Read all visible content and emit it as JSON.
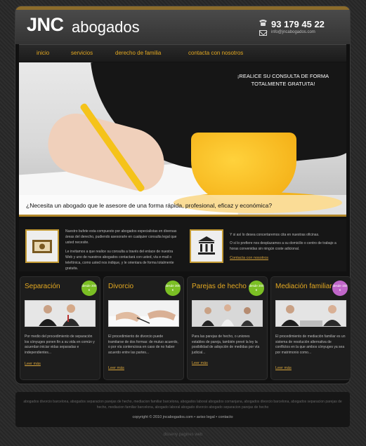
{
  "header": {
    "logo_bold": "JNC",
    "logo_rest": "abogados",
    "phone": "93 179 45 22",
    "email": "info@jncabogados.com"
  },
  "nav": {
    "items": [
      "inicio",
      "servicios",
      "derecho de familia",
      "contacta con nosotros"
    ]
  },
  "hero": {
    "promo_line1": "¡REALICE SU CONSULTA DE FORMA",
    "promo_line2": "TOTALMENTE GRATUITA!",
    "question": "¿Necesita un abogado que le asesore de una forma rápida, profesional, eficaz y económica?"
  },
  "info": {
    "left_p1": "Nuestro bufete esta compuesto por abogados especialistas en diversas áreas del derecho, pudiendo asesorarle en cualquier consulta legal que usted necesite.",
    "left_p2": "Le invitamos a que realice su consulta a través del enlace de nuestra Web y uno de nuestros abogados contactará con usted, vía e-mail o telefónica, como usted nos indique, y le orientara de forma totalmente gratuita.",
    "right_p1": "Y si así lo desea concertaremos cita en nuestras oficinas.",
    "right_p2": "O si lo prefiere nos desplazamos a su domicilio o centro de trabajo a horas convenidas sin ningún coste adicional.",
    "right_link": "Contacta con nosotros"
  },
  "cards": [
    {
      "title": "Separación",
      "badge": "desde 300 €",
      "text": "Por medio del procedimiento de separación los cónyuges ponen fin a su vida en común y acuerdan iniciar vidas separadas e independientes...",
      "more": "Leer más"
    },
    {
      "title": "Divorcio",
      "badge": "desde 300 €",
      "text": "El procedimiento de divorcio puede tramitarse de dos formas: de mutuo acuerdo, o por vía contenciosa en caso de no haber acuerdo entre las partes...",
      "more": "Leer más"
    },
    {
      "title": "Parejas de hecho",
      "badge": "desde 300 €",
      "text": "Para las parejas de hecho, o uniones estables de pareja, también prevé la ley la posibilidad de adopción de medidas por vía judicial...",
      "more": "Leer más"
    },
    {
      "title": "Mediación familiar",
      "badge": "desde 150 €",
      "text": "El procedimiento de mediación familiar es un sistema de resolución alternativa de conflictos en la que ambos cónyuges ya sea por matrimonio como...",
      "more": "Leer más"
    }
  ],
  "footer": {
    "keywords": "abogados divorcio barcelona, abogados separacion parejas de hecho, mediacion familiar barcelona, abogados laboral abogados cornanjana, abogados divorcio barcelona, abogados separacion parejas de hecho, mediacion familiar barcelona, abogado laboral abogado divorcio abogado separacion parejas de hecho",
    "copyright": "copyright © 2010 jncabogados.com • aviso legal • contacto",
    "design": "disseny pagines web"
  },
  "colors": {
    "accent": "#e3a821",
    "badge_green": "#7bbf24",
    "badge_purple": "#c066c9"
  }
}
